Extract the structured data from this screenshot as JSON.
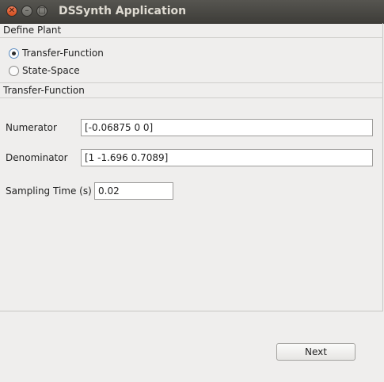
{
  "window": {
    "title": "DSSynth Application",
    "close_glyph": "✕",
    "minimize_glyph": "–",
    "maximize_glyph": "□"
  },
  "define_plant": {
    "label": "Define Plant",
    "options": [
      {
        "label": "Transfer-Function",
        "selected": true
      },
      {
        "label": "State-Space",
        "selected": false
      }
    ]
  },
  "transfer_function": {
    "label": "Transfer-Function",
    "numerator": {
      "label": "Numerator",
      "value": "[-0.06875 0 0]"
    },
    "denominator": {
      "label": "Denominator",
      "value": "[1 -1.696 0.7089]"
    },
    "sampling_time": {
      "label": "Sampling Time (s)",
      "value": "0.02"
    }
  },
  "footer": {
    "next_label": "Next"
  }
}
